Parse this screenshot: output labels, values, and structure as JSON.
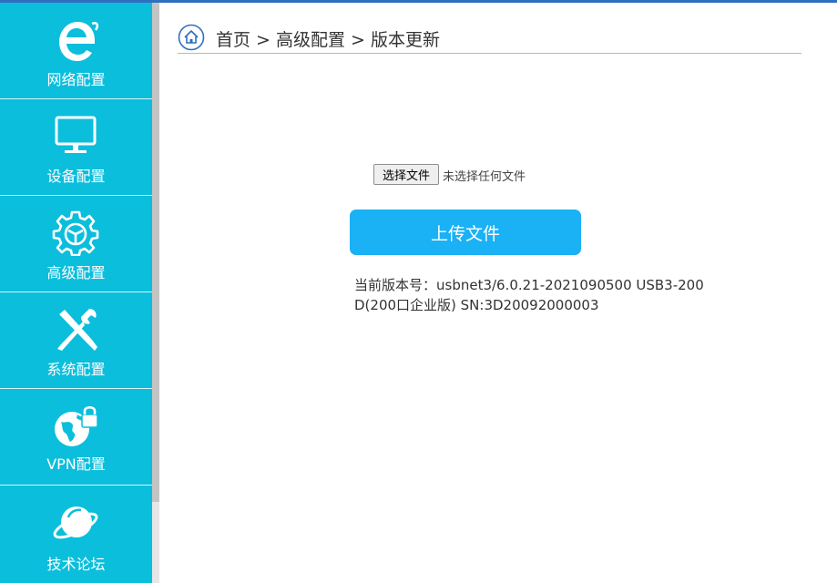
{
  "sidebar": {
    "items": [
      {
        "label": "网络配置",
        "icon": "ie-icon"
      },
      {
        "label": "设备配置",
        "icon": "monitor-icon"
      },
      {
        "label": "高级配置",
        "icon": "gear-icon"
      },
      {
        "label": "系统配置",
        "icon": "tools-icon"
      },
      {
        "label": "VPN配置",
        "icon": "globe-lock-icon"
      },
      {
        "label": "技术论坛",
        "icon": "planet-icon"
      }
    ]
  },
  "breadcrumb": {
    "path": "首页 > 高级配置 > 版本更新"
  },
  "upload": {
    "choose_label": "选择文件",
    "no_file_text": "未选择任何文件",
    "upload_label": "上传文件"
  },
  "version": {
    "text": "当前版本号：usbnet3/6.0.21-2021090500 USB3-200D(200口企业版) SN:3D20092000003"
  },
  "colors": {
    "sidebar": "#0bbedc",
    "upload_button": "#1ab1f5",
    "topbar": "#2f6fbf"
  }
}
